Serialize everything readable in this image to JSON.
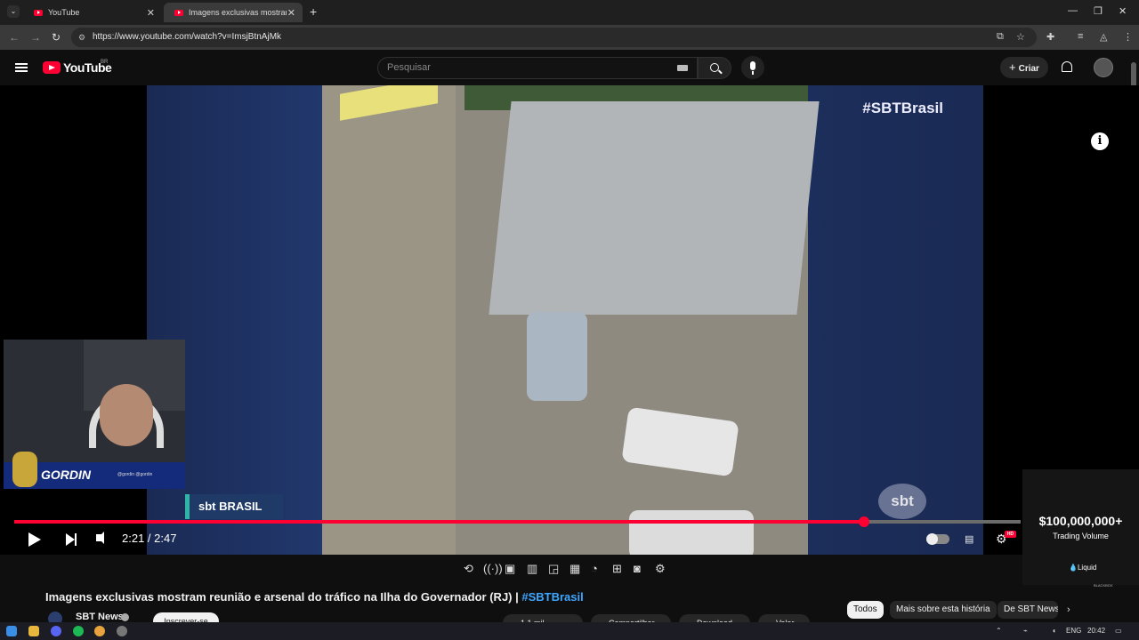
{
  "browser": {
    "tabs": [
      {
        "label": "YouTube"
      },
      {
        "label": "Imagens exclusivas mostram re"
      }
    ],
    "new_tab": "+",
    "url": "https://www.youtube.com/watch?v=ImsjBtnAjMk"
  },
  "youtube": {
    "logo_text": "YouTube",
    "region": "BR",
    "search_placeholder": "Pesquisar",
    "create_label": "Criar"
  },
  "player": {
    "overlay_hashtag": "#SBTBrasil",
    "watermark": "sbt",
    "brand_tag": "sbt BRASIL",
    "streamer_name": "GORDIN",
    "streamer_handle": "@gordin  @gordin",
    "current_time": "2:21",
    "separator": "/",
    "duration": "2:47",
    "time_display": "2:21 / 2:47",
    "progress_fraction": 0.844,
    "hd_badge": "HD"
  },
  "ad": {
    "amount": "$100,000,000+",
    "caption": "Trading Volume",
    "brand": "Liquid",
    "logo_text": "BLACKBOX"
  },
  "video": {
    "title": "Imagens exclusivas mostram reunião e arsenal do tráfico na Ilha do Governador (RJ) |",
    "title_hashtag": "#SBTBrasil",
    "channel": "SBT News",
    "subscribe": "Inscrever-se",
    "likes": "1,1 mil",
    "share": "Compartilhar",
    "download": "Download",
    "clip": "Valor"
  },
  "chips": [
    "Todos",
    "Mais sobre esta história",
    "De SBT News"
  ],
  "system": {
    "language": "ENG",
    "clock": "20:42"
  },
  "colors": {
    "accent": "#ff0033",
    "link": "#3ea6ff",
    "background": "#0f0f0f"
  }
}
